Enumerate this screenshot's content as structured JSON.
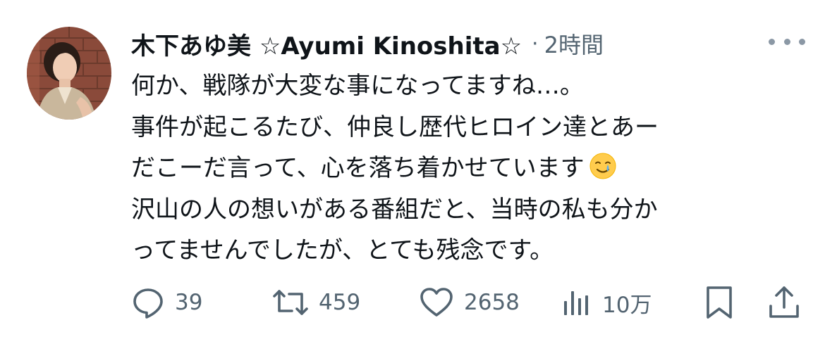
{
  "tweet": {
    "author": {
      "display_name": "木下あゆ美 ☆Ayumi Kinoshita☆",
      "separator": "·",
      "timestamp": "2時間"
    },
    "text_lines": [
      "何か、戦隊が大変な事になってますね…。",
      "事件が起こるたび、仲良し歴代ヒロイン達とあー",
      "だこーだ言って、心を落ち着かせています",
      "沢山の人の想いがある番組だと、当時の私も分か",
      "ってませんでしたが、とても残念です。"
    ],
    "emoji_name": "smiling-face-with-tear",
    "actions": {
      "reply_count": "39",
      "retweet_count": "459",
      "like_count": "2658",
      "views_count": "10万"
    }
  },
  "icons": {
    "more": "more-dots-icon",
    "reply": "reply-bubble-icon",
    "retweet": "retweet-icon",
    "like": "heart-icon",
    "views": "views-bar-chart-icon",
    "bookmark": "bookmark-icon",
    "share": "share-upload-icon"
  },
  "colors": {
    "text_primary": "#0f1419",
    "text_secondary": "#536471",
    "background": "#ffffff"
  }
}
